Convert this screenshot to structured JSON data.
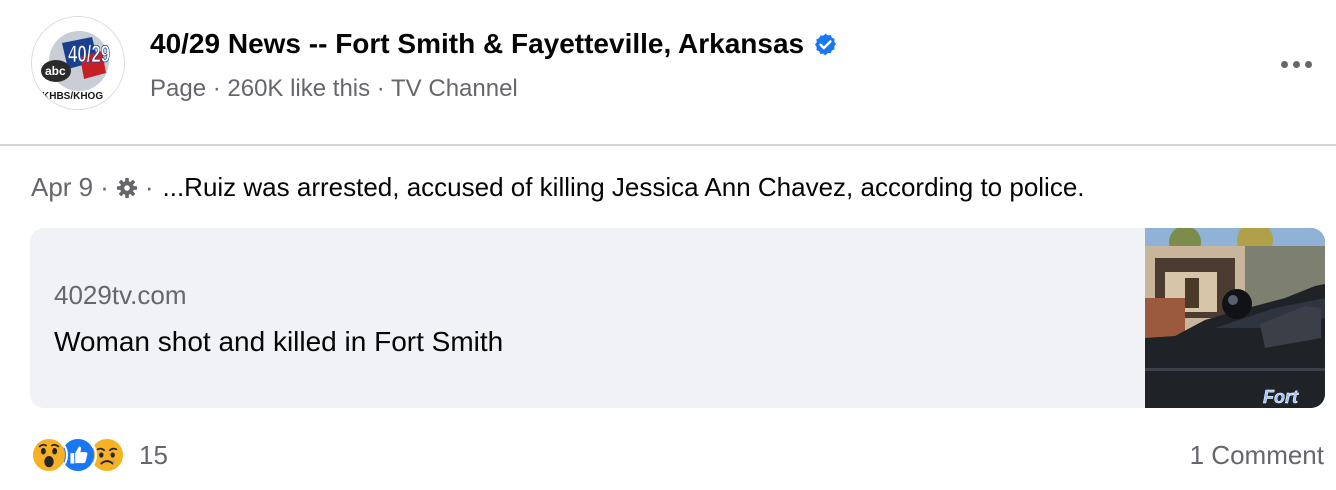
{
  "header": {
    "page_name": "40/29 News -- Fort Smith & Fayetteville, Arkansas",
    "meta": "Page · 260K like this · TV Channel",
    "avatar": {
      "logo_number": "40/29",
      "logo_network": "abc",
      "logo_caption": "KHBS/KHOG"
    },
    "verified_icon": "verified-badge-icon",
    "more_icon": "more-options-icon"
  },
  "post": {
    "date": "Apr 9",
    "separator": "·",
    "audience_icon": "gear-icon",
    "text": "...Ruiz was arrested, accused of killing Jessica Ann Chavez, according to police."
  },
  "link_card": {
    "domain": "4029tv.com",
    "title": "Woman shot and killed in Fort Smith",
    "thumbnail_text": "Fort"
  },
  "footer": {
    "reactions": [
      "wow-reaction-icon",
      "like-reaction-icon",
      "sad-reaction-icon"
    ],
    "reaction_count": "15",
    "comments": "1 Comment"
  },
  "colors": {
    "text_primary": "#050505",
    "text_secondary": "#65676b",
    "card_bg": "#f0f2f5",
    "verified_blue": "#1877f2",
    "like_blue": "#1877f2",
    "emoji_yellow": "#f7b125"
  }
}
